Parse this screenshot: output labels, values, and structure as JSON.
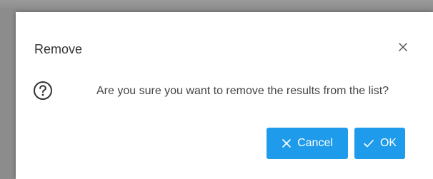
{
  "dialog": {
    "title": "Remove",
    "message": "Are you sure you want to remove the results from the list?",
    "icon": "question-circle-icon",
    "close_icon": "close-icon"
  },
  "buttons": {
    "cancel_label": "Cancel",
    "cancel_icon": "x-icon",
    "ok_label": "OK",
    "ok_icon": "check-icon"
  },
  "colors": {
    "primary": "#1e9bea",
    "backdrop": "#8c8c8c",
    "text": "#333333"
  }
}
